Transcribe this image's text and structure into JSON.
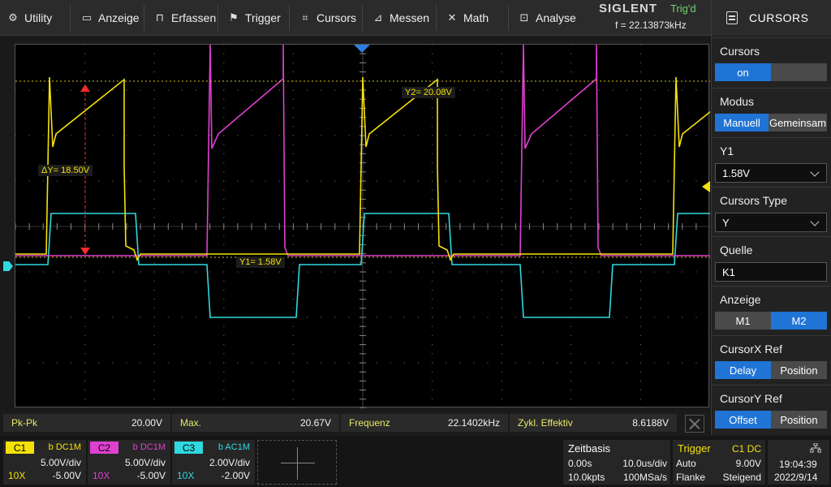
{
  "topbar": {
    "menu": [
      {
        "id": "utility",
        "label": "Utility",
        "icon": "gear-icon",
        "glyph": "⚙"
      },
      {
        "id": "anzeige",
        "label": "Anzeige",
        "icon": "display-icon",
        "glyph": "▭"
      },
      {
        "id": "erfassen",
        "label": "Erfassen",
        "icon": "acquire-icon",
        "glyph": "⊓"
      },
      {
        "id": "trigger",
        "label": "Trigger",
        "icon": "flag-icon",
        "glyph": "⚑"
      },
      {
        "id": "cursors",
        "label": "Cursors",
        "icon": "cursor-grid-icon",
        "glyph": "⌗"
      },
      {
        "id": "messen",
        "label": "Messen",
        "icon": "measure-icon",
        "glyph": "⊿"
      },
      {
        "id": "math",
        "label": "Math",
        "icon": "math-icon",
        "glyph": "✕"
      },
      {
        "id": "analyse",
        "label": "Analyse",
        "icon": "analysis-icon",
        "glyph": "⊡"
      }
    ],
    "brand": "SIGLENT",
    "trig_status": "Trig'd",
    "trig_freq": "f = 22.13873kHz"
  },
  "panel": {
    "title": "CURSORS",
    "cursors": {
      "label": "Cursors",
      "options": [
        "on",
        ""
      ],
      "active": 0
    },
    "modus": {
      "label": "Modus",
      "options": [
        "Manuell",
        "Gemeinsam"
      ],
      "active": 0
    },
    "y1": {
      "label": "Y1",
      "value": "1.58V"
    },
    "cursors_type": {
      "label": "Cursors Type",
      "value": "Y"
    },
    "quelle": {
      "label": "Quelle",
      "value": "K1"
    },
    "anzeige": {
      "label": "Anzeige",
      "options": [
        "M1",
        "M2"
      ],
      "active": 1
    },
    "cursorx_ref": {
      "label": "CursorX Ref",
      "options": [
        "Delay",
        "Position"
      ],
      "active": 0
    },
    "cursory_ref": {
      "label": "CursorY Ref",
      "options": [
        "Offset",
        "Position"
      ],
      "active": 0
    }
  },
  "cursor_readouts": {
    "y2": "Y2= 20.08V",
    "delta_y": "ΔY= 18.50V",
    "y1": "Y1= 1.58V"
  },
  "measurements": [
    {
      "label": "Pk-Pk",
      "value": "20.00V"
    },
    {
      "label": "Max.",
      "value": "20.67V"
    },
    {
      "label": "Frequenz",
      "value": "22.1402kHz"
    },
    {
      "label": "Zykl. Effektiv",
      "value": "8.6188V"
    }
  ],
  "channels": [
    {
      "tag": "C1",
      "coupling": "b DC1M",
      "scale": "5.00V/div",
      "probe": "10X",
      "offset": "-5.00V",
      "color": "#f5e10a"
    },
    {
      "tag": "C2",
      "coupling": "b DC1M",
      "scale": "5.00V/div",
      "probe": "10X",
      "offset": "-5.00V",
      "color": "#e040d0"
    },
    {
      "tag": "C3",
      "coupling": "b AC1M",
      "scale": "2.00V/div",
      "probe": "10X",
      "offset": "-2.00V",
      "color": "#30d8e0"
    }
  ],
  "timebase": {
    "title": "Zeitbasis",
    "delay": "0.00s",
    "scale": "10.0us/div",
    "points": "10.0kpts",
    "rate": "100MSa/s"
  },
  "trigger": {
    "title": "Trigger",
    "source": "C1 DC",
    "mode": "Auto",
    "level": "9.00V",
    "type": "Flanke",
    "slope": "Steigend"
  },
  "clock": {
    "time": "19:04:39",
    "date": "2022/9/14",
    "icon": "network-icon"
  },
  "colors": {
    "ch1": "#f5e10a",
    "ch2": "#e040d0",
    "ch3": "#30d8e0",
    "accent": "#1f74d6",
    "cursor_marker": "#ff2a2a",
    "trigger_marker": "#2f7de0"
  }
}
